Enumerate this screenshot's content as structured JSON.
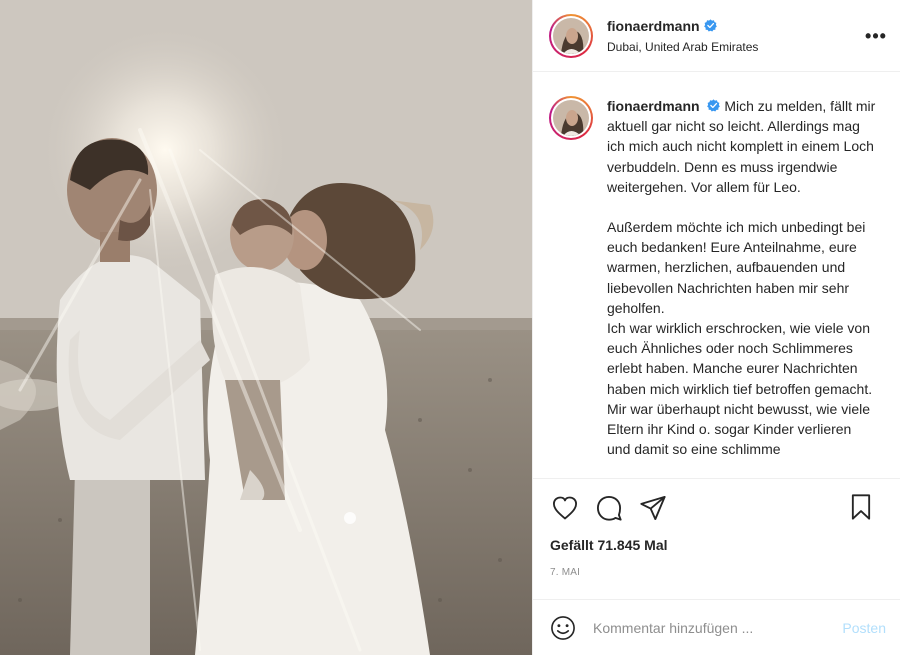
{
  "header": {
    "username": "fionaerdmann",
    "location": "Dubai, United Arab Emirates",
    "more_label": "•••"
  },
  "caption": {
    "username": "fionaerdmann",
    "paragraph1": "Mich zu melden, fällt mir aktuell gar nicht so leicht. Allerdings mag ich mich auch nicht komplett in einem Loch verbuddeln. Denn es muss irgendwie weitergehen. Vor allem für Leo.",
    "paragraph2": "Außerdem möchte ich mich unbedingt bei euch bedanken! Eure Anteilnahme, eure warmen, herzlichen, aufbauenden und liebevollen Nachrichten haben mir sehr geholfen.",
    "paragraph3": "Ich war wirklich erschrocken, wie viele von euch Ähnliches oder noch Schlimmeres erlebt haben. Manche eurer Nachrichten haben mich wirklich tief betroffen gemacht. Mir war überhaupt nicht bewusst, wie viele Eltern ihr Kind o. sogar Kinder verlieren und damit so eine schlimme"
  },
  "actions": {
    "like_icon": "heart-icon",
    "comment_icon": "comment-icon",
    "share_icon": "paper-plane-icon",
    "save_icon": "bookmark-icon"
  },
  "likes": "Gefällt 71.845 Mal",
  "date": "7. MAI",
  "comment": {
    "placeholder": "Kommentar hinzufügen ...",
    "post_label": "Posten",
    "emoji_icon": "smiley-icon"
  },
  "colors": {
    "verified": "#3897f0",
    "post_button_disabled": "#b2dffc",
    "text": "#262626",
    "muted": "#8e8e8e",
    "divider": "#efefef"
  }
}
